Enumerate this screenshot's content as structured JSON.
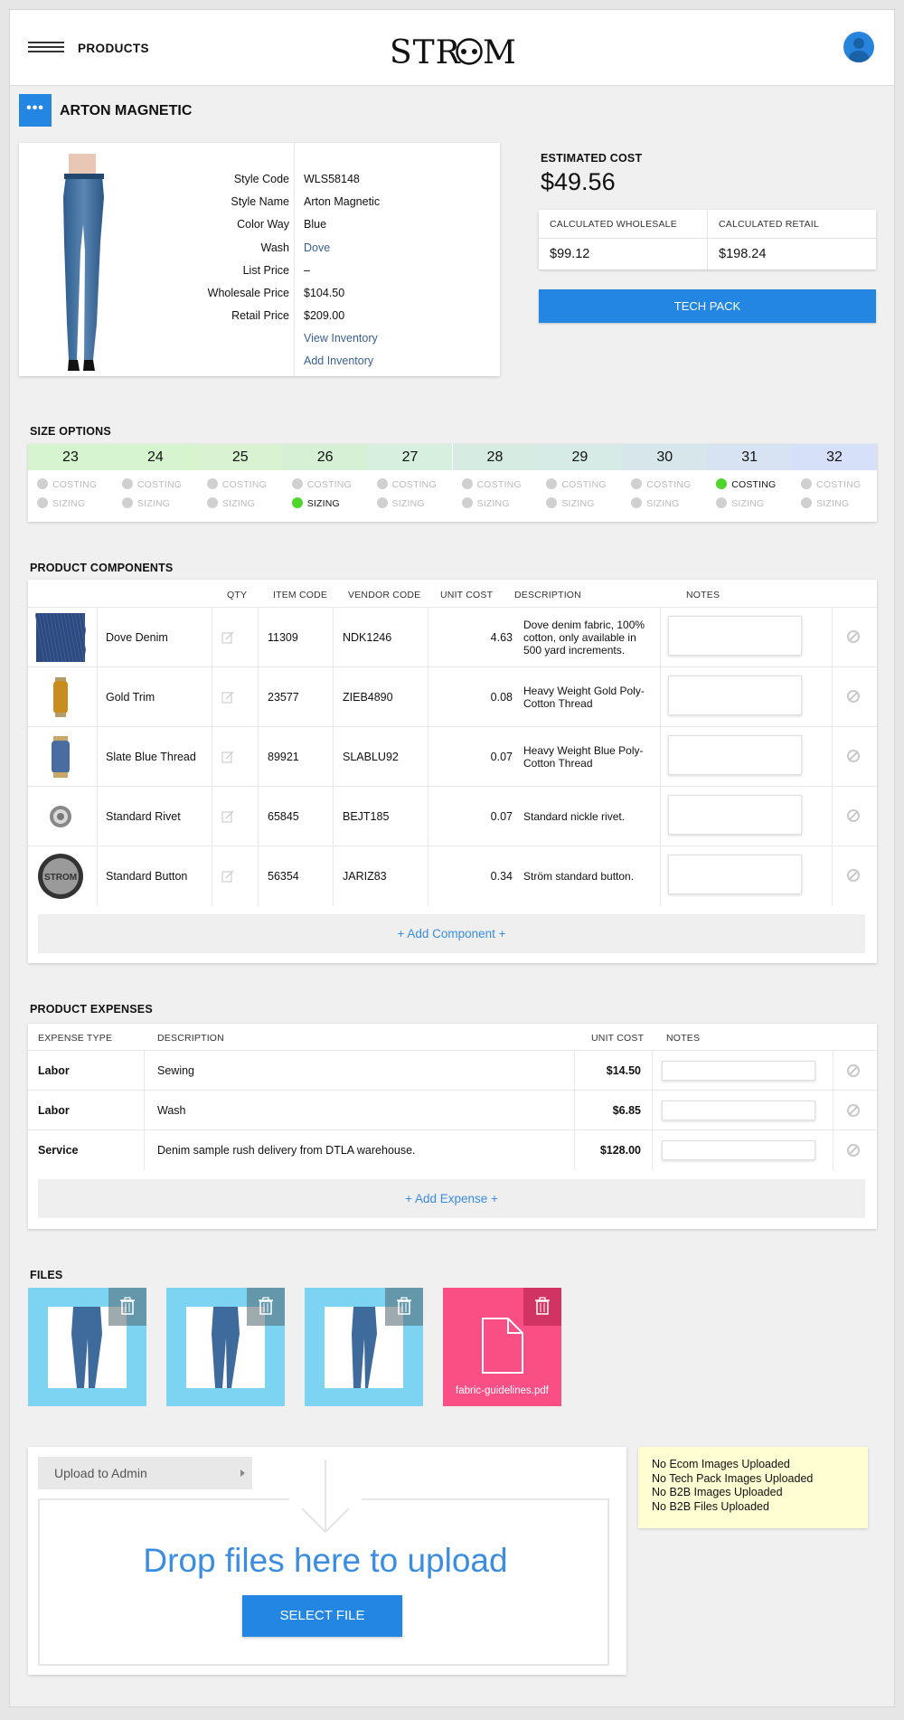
{
  "header": {
    "nav_title": "PRODUCTS",
    "logo": "STROM"
  },
  "product": {
    "title": "ARTON MAGNETIC",
    "fields": [
      {
        "label": "Style Code",
        "value": "WLS58148"
      },
      {
        "label": "Style Name",
        "value": "Arton Magnetic"
      },
      {
        "label": "Color Way",
        "value": "Blue"
      },
      {
        "label": "Wash",
        "value": "Dove"
      },
      {
        "label": "List Price",
        "value": "–"
      },
      {
        "label": "Wholesale Price",
        "value": "$104.50"
      },
      {
        "label": "Retail Price",
        "value": "$209.00"
      }
    ],
    "view_inventory": "View Inventory",
    "add_inventory": "Add Inventory"
  },
  "cost": {
    "label": "ESTIMATED COST",
    "value": "$49.56",
    "wholesale_label": "CALCULATED WHOLESALE",
    "wholesale_value": "$99.12",
    "retail_label": "CALCULATED RETAIL",
    "retail_value": "$198.24",
    "tech_pack": "TECH PACK"
  },
  "sizes": {
    "title": "SIZE OPTIONS",
    "costing_label": "COSTING",
    "sizing_label": "SIZING",
    "items": [
      {
        "size": "23",
        "color": "#d6f5cf",
        "costing": false,
        "sizing": false
      },
      {
        "size": "24",
        "color": "#d6f5cf",
        "costing": false,
        "sizing": false
      },
      {
        "size": "25",
        "color": "#d8f2d2",
        "costing": false,
        "sizing": false
      },
      {
        "size": "26",
        "color": "#d6f0d6",
        "costing": false,
        "sizing": true
      },
      {
        "size": "27",
        "color": "#d6efde",
        "costing": false,
        "sizing": false
      },
      {
        "size": "28",
        "color": "#d6ece3",
        "costing": false,
        "sizing": false
      },
      {
        "size": "29",
        "color": "#d6eae6",
        "costing": false,
        "sizing": false
      },
      {
        "size": "30",
        "color": "#d6e6ea",
        "costing": false,
        "sizing": false
      },
      {
        "size": "31",
        "color": "#d7e2f3",
        "costing": true,
        "sizing": false
      },
      {
        "size": "32",
        "color": "#d6e0f8",
        "costing": false,
        "sizing": false
      }
    ]
  },
  "components": {
    "title": "PRODUCT COMPONENTS",
    "headers": {
      "qty": "QTY",
      "item_code": "ITEM CODE",
      "vendor_code": "VENDOR CODE",
      "unit_cost": "UNIT COST",
      "description": "DESCRIPTION",
      "notes": "NOTES"
    },
    "rows": [
      {
        "name": "Dove Denim",
        "item_code": "11309",
        "vendor_code": "NDK1246",
        "unit_cost": "4.63",
        "description": "Dove denim fabric, 100% cotton, only available in 500 yard increments.",
        "thumb": "denim"
      },
      {
        "name": "Gold Trim",
        "item_code": "23577",
        "vendor_code": "ZIEB4890",
        "unit_cost": "0.08",
        "description": "Heavy Weight Gold Poly-Cotton Thread",
        "thumb": "gold-spool"
      },
      {
        "name": "Slate Blue Thread",
        "item_code": "89921",
        "vendor_code": "SLABLU92",
        "unit_cost": "0.07",
        "description": "Heavy Weight Blue Poly-Cotton Thread",
        "thumb": "blue-spool"
      },
      {
        "name": "Standard Rivet",
        "item_code": "65845",
        "vendor_code": "BEJT185",
        "unit_cost": "0.07",
        "description": "Standard nickle rivet.",
        "thumb": "rivet"
      },
      {
        "name": "Standard Button",
        "item_code": "56354",
        "vendor_code": "JARIZ83",
        "unit_cost": "0.34",
        "description": "Ström standard button.",
        "thumb": "button",
        "thumb_text": "STROM"
      }
    ],
    "add_label": "+ Add Component +"
  },
  "expenses": {
    "title": "PRODUCT EXPENSES",
    "headers": {
      "type": "EXPENSE TYPE",
      "description": "DESCRIPTION",
      "unit_cost": "UNIT COST",
      "notes": "NOTES"
    },
    "rows": [
      {
        "type": "Labor",
        "description": "Sewing",
        "unit_cost": "$14.50"
      },
      {
        "type": "Labor",
        "description": "Wash",
        "unit_cost": "$6.85"
      },
      {
        "type": "Service",
        "description": "Denim sample rush delivery from DTLA warehouse.",
        "unit_cost": "$128.00"
      }
    ],
    "add_label": "+ Add Expense +"
  },
  "files": {
    "title": "FILES",
    "items": [
      {
        "kind": "image"
      },
      {
        "kind": "image"
      },
      {
        "kind": "image"
      },
      {
        "kind": "pdf",
        "name": "fabric-guidelines.pdf"
      }
    ]
  },
  "upload": {
    "select_label": "Upload to Admin",
    "drop_text": "Drop files here to upload",
    "select_file": "SELECT FILE"
  },
  "notices": [
    "No Ecom Images Uploaded",
    "No Tech Pack Images Uploaded",
    "No B2B Images Uploaded",
    "No B2B Files Uploaded"
  ]
}
